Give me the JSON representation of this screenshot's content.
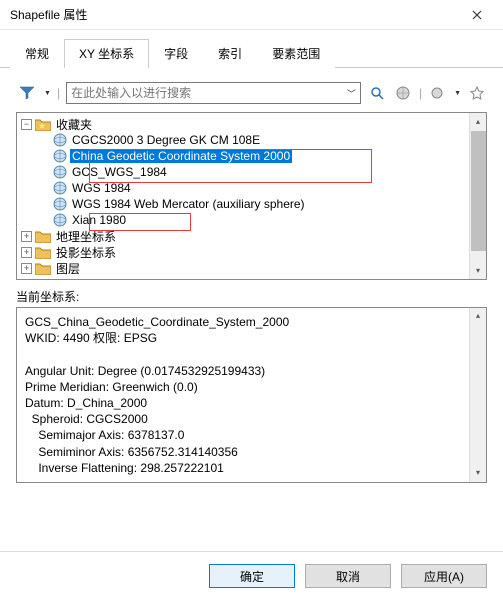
{
  "window": {
    "title": "Shapefile 属性"
  },
  "tabs": {
    "general": "常规",
    "xy": "XY 坐标系",
    "fields": "字段",
    "index": "索引",
    "extent": "要素范围"
  },
  "search": {
    "placeholder": "在此处输入以进行搜索"
  },
  "tree": {
    "favorites": "收藏夹",
    "items": {
      "cgcs2000": "CGCS2000 3 Degree GK CM 108E",
      "china2000": "China Geodetic Coordinate System 2000",
      "gcswgs84": "GCS_WGS_1984",
      "wgs84": "WGS 1984",
      "wgs84merc": "WGS 1984 Web Mercator (auxiliary sphere)",
      "xian80": "Xian 1980"
    },
    "geographic": "地理坐标系",
    "projected": "投影坐标系",
    "layers": "图层"
  },
  "current_label": "当前坐标系:",
  "details_text": "GCS_China_Geodetic_Coordinate_System_2000\nWKID: 4490 权限: EPSG\n\nAngular Unit: Degree (0.0174532925199433)\nPrime Meridian: Greenwich (0.0)\nDatum: D_China_2000\n  Spheroid: CGCS2000\n    Semimajor Axis: 6378137.0\n    Semiminor Axis: 6356752.314140356\n    Inverse Flattening: 298.257222101",
  "buttons": {
    "ok": "确定",
    "cancel": "取消",
    "apply": "应用(A)"
  }
}
